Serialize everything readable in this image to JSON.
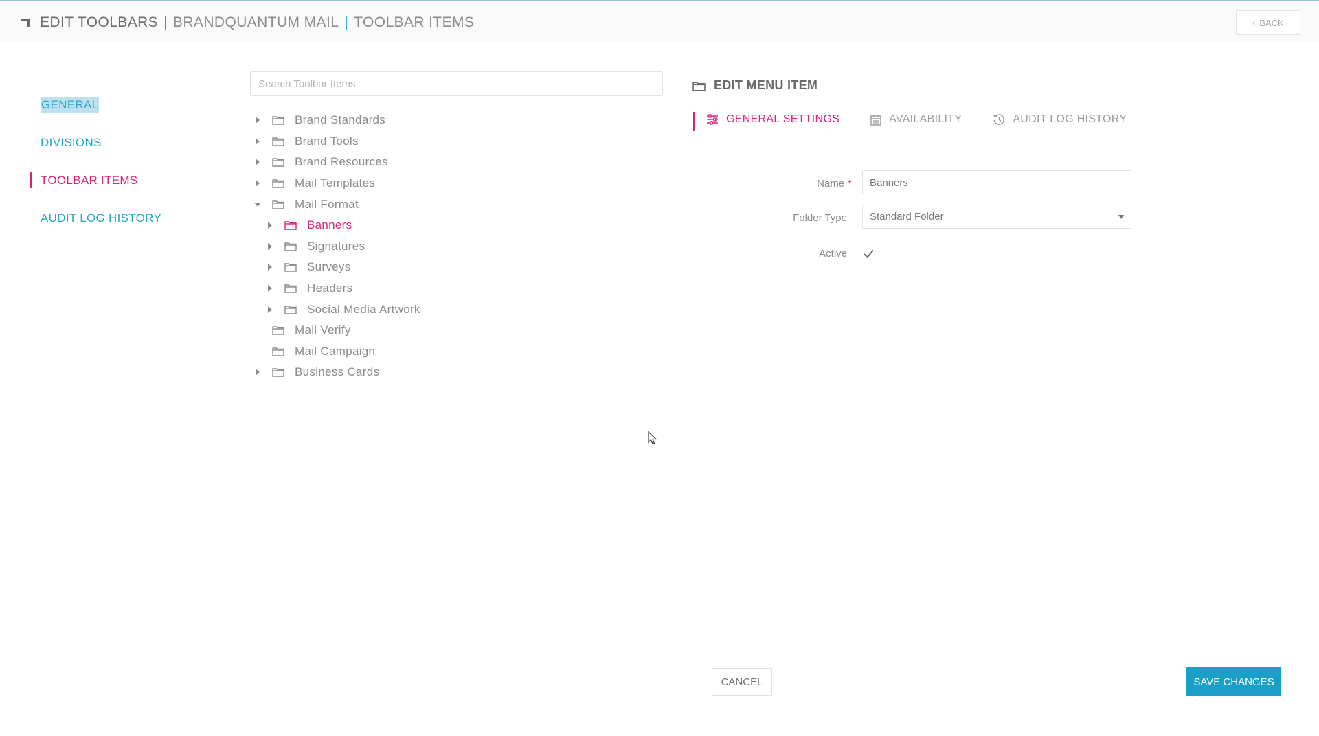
{
  "header": {
    "title": "EDIT TOOLBARS",
    "separator": "|",
    "toolbar_name": "BRANDQUANTUM MAIL",
    "section": "TOOLBAR ITEMS",
    "back_label": "BACK"
  },
  "sidenav": {
    "items": [
      {
        "label": "GENERAL"
      },
      {
        "label": "DIVISIONS"
      },
      {
        "label": "TOOLBAR ITEMS"
      },
      {
        "label": "AUDIT LOG HISTORY"
      }
    ]
  },
  "search": {
    "placeholder": "Search Toolbar Items",
    "value": ""
  },
  "tree": {
    "items": [
      {
        "label": "Brand Standards"
      },
      {
        "label": "Brand Tools"
      },
      {
        "label": "Brand Resources"
      },
      {
        "label": "Mail Templates"
      },
      {
        "label": "Mail Format"
      },
      {
        "label": "Banners"
      },
      {
        "label": "Signatures"
      },
      {
        "label": "Surveys"
      },
      {
        "label": "Headers"
      },
      {
        "label": "Social Media Artwork"
      },
      {
        "label": "Mail Verify"
      },
      {
        "label": "Mail Campaign"
      },
      {
        "label": "Business Cards"
      }
    ]
  },
  "edit_panel": {
    "title": "EDIT MENU ITEM",
    "tabs": [
      {
        "label": "GENERAL SETTINGS"
      },
      {
        "label": "AVAILABILITY"
      },
      {
        "label": "AUDIT LOG HISTORY"
      }
    ],
    "form": {
      "name_label": "Name",
      "required_mark": "*",
      "name_value": "Banners",
      "folder_type_label": "Folder Type",
      "folder_type_value": "Standard Folder",
      "active_label": "Active",
      "active_checked": true
    }
  },
  "actions": {
    "cancel_label": "CANCEL",
    "save_label": "SAVE CHANGES"
  },
  "colors": {
    "accent_pink": "#d8237a",
    "accent_blue": "#1aa0c8",
    "link_blue": "#28a7c8"
  },
  "icons": {
    "title": "toolbar-corner-icon",
    "back": "chevron-left-icon",
    "tree_folder": "folder-icon",
    "tree_expand": "caret-right-icon",
    "tree_collapse": "caret-down-icon",
    "general_settings": "sliders-icon",
    "availability": "calendar-icon",
    "audit_log": "history-icon",
    "active": "checkmark-icon"
  }
}
